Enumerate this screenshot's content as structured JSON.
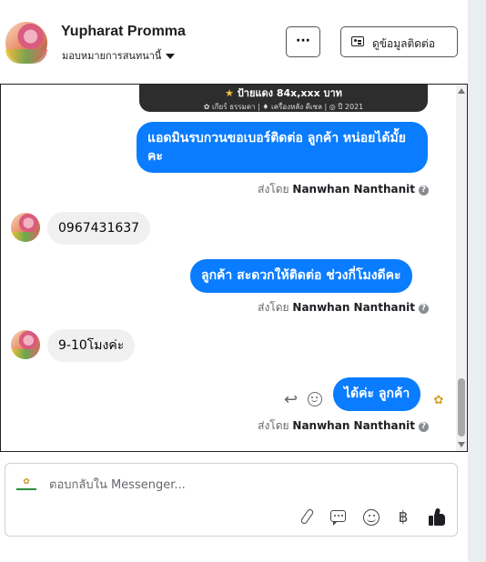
{
  "header": {
    "name": "Yupharat Promma",
    "assign_label": "มอบหมายการสนทนานี้",
    "more_label": "···",
    "contact_label": "ดูข้อมูลติดต่อ"
  },
  "banner": {
    "line1_star": "★",
    "line1_text": "ป้ายแดง 84x,xxx บาท",
    "line2_text": "✿ เกียร์ ธรรมดา  |  ♦ เครื่องหลัง ดีเซล  |  ◎ ปี 2021"
  },
  "messages": [
    {
      "direction": "out",
      "text": "แอดมินรบกวนขอเบอร์ติดต่อ ลูกค้า  หน่อยได้มั้ยคะ"
    },
    {
      "direction": "in",
      "text": "0967431637"
    },
    {
      "direction": "out",
      "text": "ลูกค้า  สะดวกให้ติดต่อ ช่วงกี่โมงดีคะ"
    },
    {
      "direction": "in",
      "text": "9-10โมงค่ะ"
    },
    {
      "direction": "out",
      "text": "ได้ค่ะ  ลูกค้า"
    }
  ],
  "sent_by": {
    "prefix": "ส่งโดย",
    "name": "Nanwhan Nanthanit",
    "help": "?"
  },
  "reply_icon": "↩",
  "seen_logo": "✿",
  "composer": {
    "page_logo": "✿",
    "placeholder": "ตอบกลับใน Messenger...",
    "baht_symbol": "฿"
  },
  "colors": {
    "outgoing_bubble": "#0a7cff",
    "incoming_bubble": "#f0f0f0"
  }
}
